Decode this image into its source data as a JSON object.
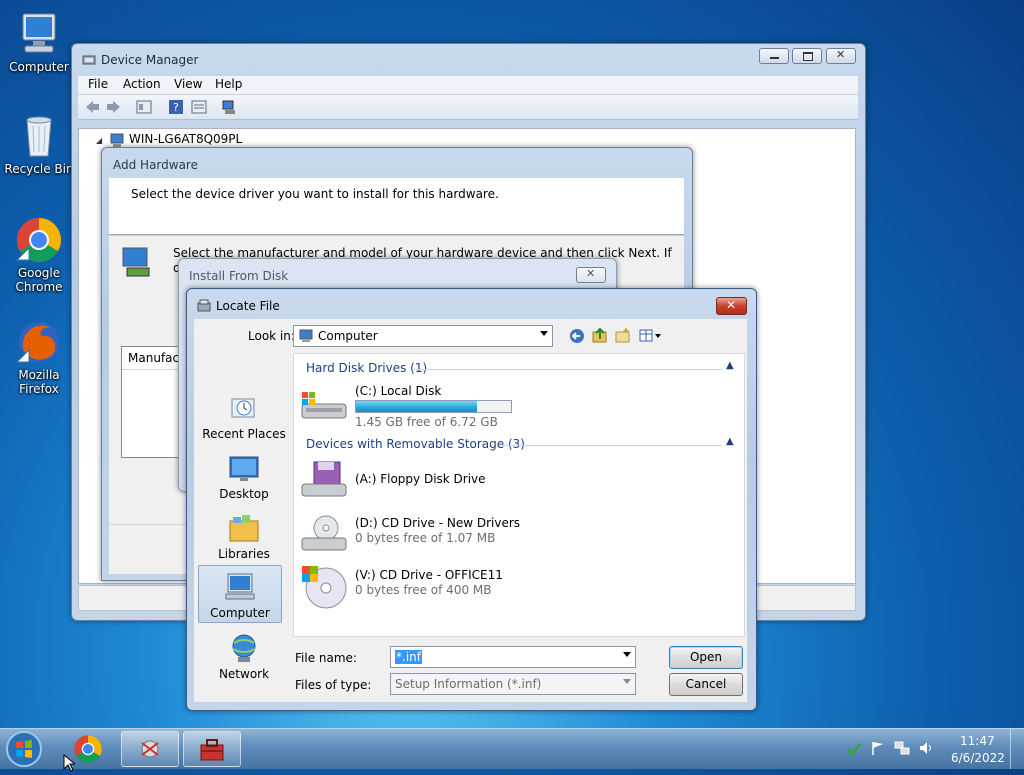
{
  "desktop": {
    "icons": [
      {
        "label": "Computer"
      },
      {
        "label": "Recycle Bin"
      },
      {
        "label": "Google Chrome"
      },
      {
        "label": "Mozilla Firefox"
      }
    ]
  },
  "device_manager": {
    "title": "Device Manager",
    "menu": {
      "file": "File",
      "action": "Action",
      "view": "View",
      "help": "Help"
    },
    "tree_root": "WIN-LG6AT8Q09PL"
  },
  "add_hardware": {
    "title": "Add Hardware",
    "heading": "Select the device driver you want to install for this hardware.",
    "instructions": "Select the manufacturer and model of your hardware device and then click Next. If you have a",
    "instructions_cont": "d",
    "manufacturer_label": "Manufact"
  },
  "install_from_disk": {
    "title": "Install From Disk"
  },
  "locate_file": {
    "title": "Locate File",
    "look_in_label": "Look in:",
    "look_in_value": "Computer",
    "sidebar": [
      {
        "label": "Recent Places"
      },
      {
        "label": "Desktop"
      },
      {
        "label": "Libraries"
      },
      {
        "label": "Computer"
      },
      {
        "label": "Network"
      }
    ],
    "groups": {
      "hard_disks": "Hard Disk Drives (1)",
      "removable": "Devices with Removable Storage (3)"
    },
    "drives": {
      "c": {
        "name": "(C:) Local Disk",
        "sub": "1.45 GB free of 6.72 GB",
        "used_fraction": 0.78
      },
      "a": {
        "name": "(A:) Floppy Disk Drive"
      },
      "d": {
        "name": "(D:) CD Drive - New Drivers",
        "sub": "0 bytes free of 1.07 MB"
      },
      "v": {
        "name": "(V:) CD Drive - OFFICE11",
        "sub": "0 bytes free of 400 MB"
      }
    },
    "file_name_label": "File name:",
    "file_name_value": "*.inf",
    "files_of_type_label": "Files of type:",
    "files_of_type_value": "Setup Information (*.inf)",
    "open_button": "Open",
    "cancel_button": "Cancel"
  },
  "taskbar": {
    "time": "11:47",
    "date": "6/6/2022"
  },
  "colors": {
    "accent": "#1e3f86",
    "progress": "#27a6d9"
  }
}
